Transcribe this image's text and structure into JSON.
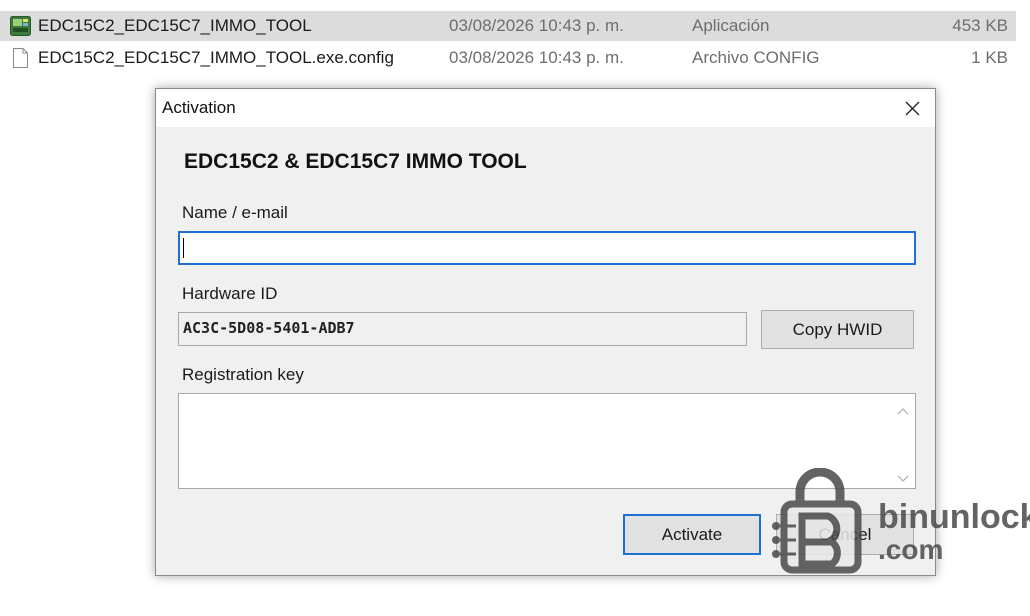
{
  "explorer": {
    "files": [
      {
        "name": "EDC15C2_EDC15C7_IMMO_TOOL",
        "date": "03/08/2026 10:43 p. m.",
        "type": "Aplicación",
        "size": "453 KB",
        "icon": "application-icon"
      },
      {
        "name": "EDC15C2_EDC15C7_IMMO_TOOL.exe.config",
        "date": "03/08/2026 10:43 p. m.",
        "type": "Archivo CONFIG",
        "size": "1 KB",
        "icon": "document-icon"
      }
    ]
  },
  "dialog": {
    "window_title": "Activation",
    "app_title": "EDC15C2 & EDC15C7 IMMO TOOL",
    "name_label": "Name / e-mail",
    "name_value": "",
    "hwid_label": "Hardware ID",
    "hwid_value": "AC3C-5D08-5401-ADB7",
    "copy_hwid_label": "Copy HWID",
    "regkey_label": "Registration key",
    "regkey_value": "",
    "activate_label": "Activate",
    "cancel_label": "Cancel"
  },
  "watermark": {
    "line1": "binunlock",
    "line2": ".com"
  },
  "colors": {
    "accent": "#1f6fd1",
    "selection": "#dcdcdc",
    "dialog_bg": "#f0f0f0"
  }
}
